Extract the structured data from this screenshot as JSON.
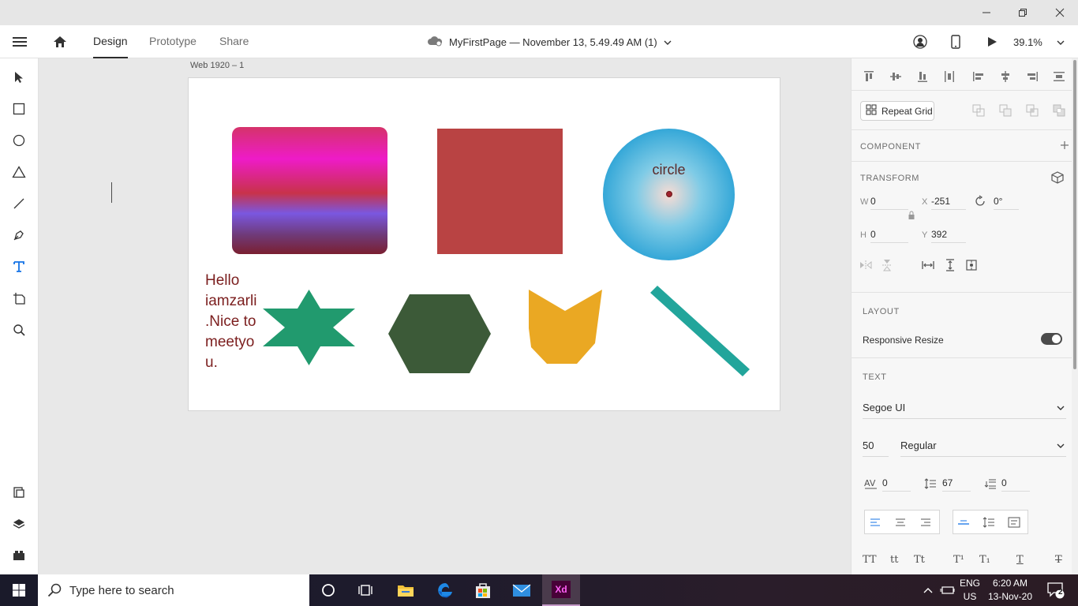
{
  "window": {
    "minimize_icon": "minimize-icon",
    "restore_icon": "restore-icon",
    "close_icon": "close-icon"
  },
  "appbar": {
    "tabs": [
      {
        "label": "Design",
        "active": true
      },
      {
        "label": "Prototype",
        "active": false
      },
      {
        "label": "Share",
        "active": false
      }
    ],
    "doc_title": "MyFirstPage — November 13, 5.49.49 AM (1)",
    "zoom": "39.1%"
  },
  "tools": [
    "select",
    "rectangle",
    "ellipse",
    "polygon",
    "line",
    "pen",
    "text",
    "artboard",
    "zoom",
    "plugins",
    "layers",
    "assets"
  ],
  "canvas": {
    "artboard_label": "Web 1920 – 1",
    "circle_text": "circle",
    "text_block": "Hello iamzarli.Nice to meetyou.",
    "colors": {
      "red_rect": "#b94343",
      "star": "#219a6e",
      "hexagon": "#3c5a38",
      "pentagon": "#eaa823",
      "line": "#22a59b",
      "text": "#7b1e1e"
    }
  },
  "panel": {
    "repeat_grid": "Repeat Grid",
    "component_head": "COMPONENT",
    "transform_head": "TRANSFORM",
    "w_label": "W",
    "w": "0",
    "h_label": "H",
    "h": "0",
    "x_label": "X",
    "x": "-251",
    "y_label": "Y",
    "y": "392",
    "rotation": "0°",
    "layout_head": "LAYOUT",
    "responsive_resize": "Responsive Resize",
    "responsive_on": true,
    "text_head": "TEXT",
    "font_family": "Segoe UI",
    "font_size": "50",
    "font_weight": "Regular",
    "char_spacing": "0",
    "line_spacing": "67",
    "para_spacing": "0",
    "typo_buttons": [
      "TT",
      "tt",
      "Tt",
      "T¹",
      "T₁",
      "T",
      "T"
    ]
  },
  "taskbar": {
    "search_placeholder": "Type here to search",
    "lang_top": "ENG",
    "lang_bottom": "US",
    "time": "6:20 AM",
    "date": "13-Nov-20",
    "notifications": "2",
    "xd_label": "Xd"
  }
}
